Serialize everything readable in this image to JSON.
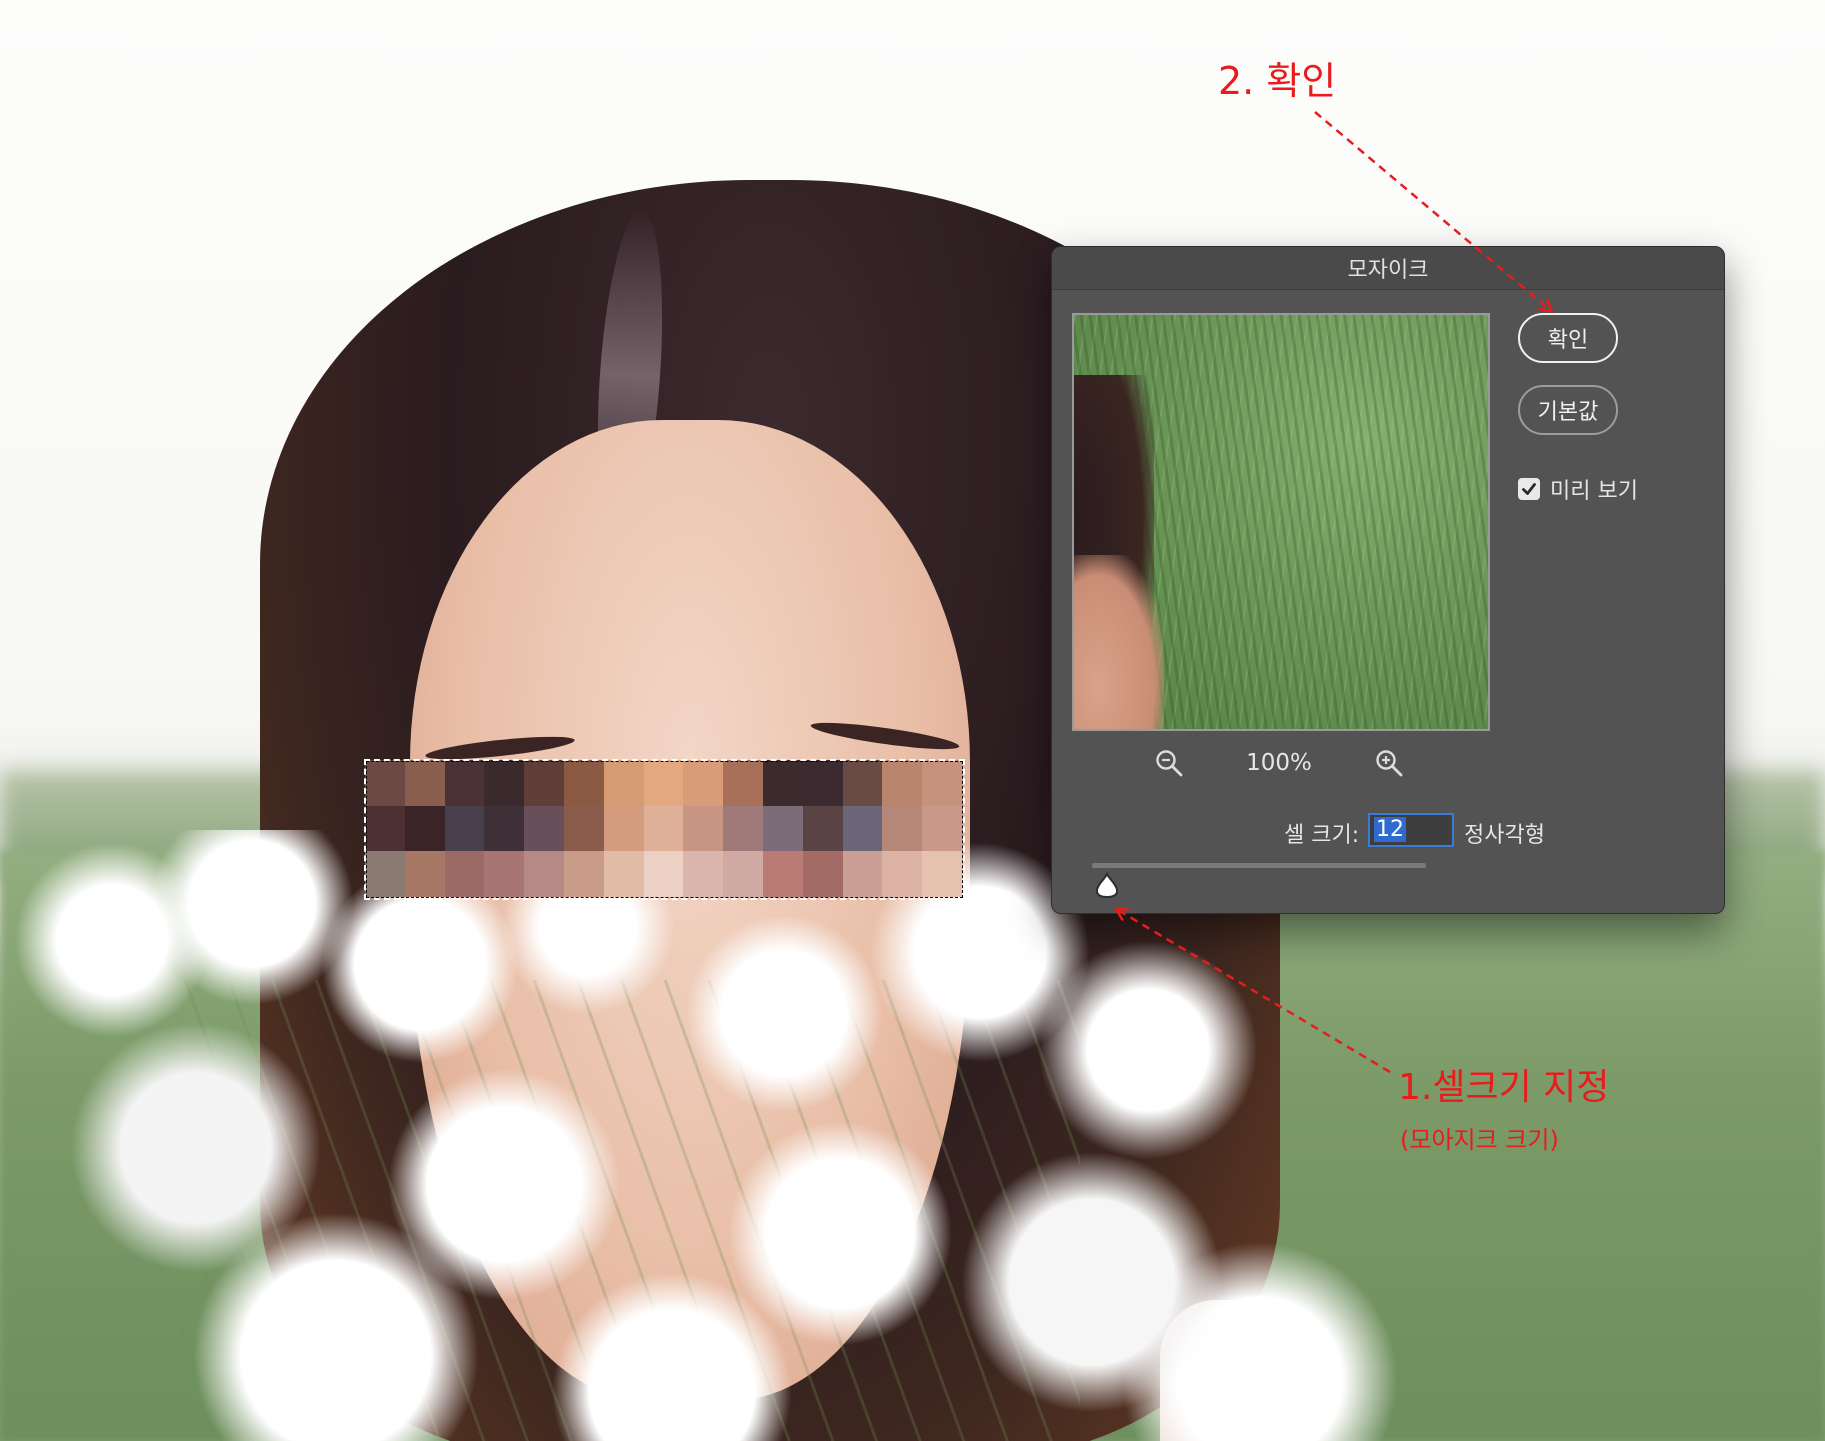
{
  "dialog": {
    "title": "모자이크",
    "ok_label": "확인",
    "default_label": "기본값",
    "preview_label": "미리 보기",
    "preview_checked": true,
    "zoom_level": "100%",
    "zoom_out_icon": "zoom-out-icon",
    "zoom_in_icon": "zoom-in-icon",
    "cell_size_label": "셀 크기:",
    "cell_size_value": "12",
    "cell_size_unit": "정사각형",
    "slider_value": 12
  },
  "annotations": {
    "step2": "2. 확인",
    "step1": "1.셀크기 지정",
    "step1_sub": "(모아지크 크기)"
  },
  "colors": {
    "annotation": "#e81c1c",
    "dialog_bg": "#535353",
    "input_focus": "#3a7bd5"
  },
  "mosaic_colors": [
    "#6b4a45",
    "#8a5e4f",
    "#4a3236",
    "#3a2a2e",
    "#5e3e36",
    "#8b5a42",
    "#d59c73",
    "#e3a87f",
    "#d89d78",
    "#a87058",
    "#3d2a2e",
    "#3b2a2f",
    "#6a4a44",
    "#b9856c",
    "#c7927c",
    "#4d3033",
    "#3a2428",
    "#48414d",
    "#3e3036",
    "#67505a",
    "#8a5c4c",
    "#d39c7f",
    "#ddb097",
    "#c79582",
    "#a07a78",
    "#7c6c7a",
    "#5a4344",
    "#6a6678",
    "#b48779",
    "#c9988a",
    "#8a7a72",
    "#a77866",
    "#9c6a66",
    "#a67574",
    "#b48986",
    "#c99c8a",
    "#e2bba6",
    "#ecd0c3",
    "#dcb6ac",
    "#cfa9a2",
    "#b97b73",
    "#a26b65",
    "#c99f96",
    "#dcb2a5",
    "#e6c1b0"
  ]
}
